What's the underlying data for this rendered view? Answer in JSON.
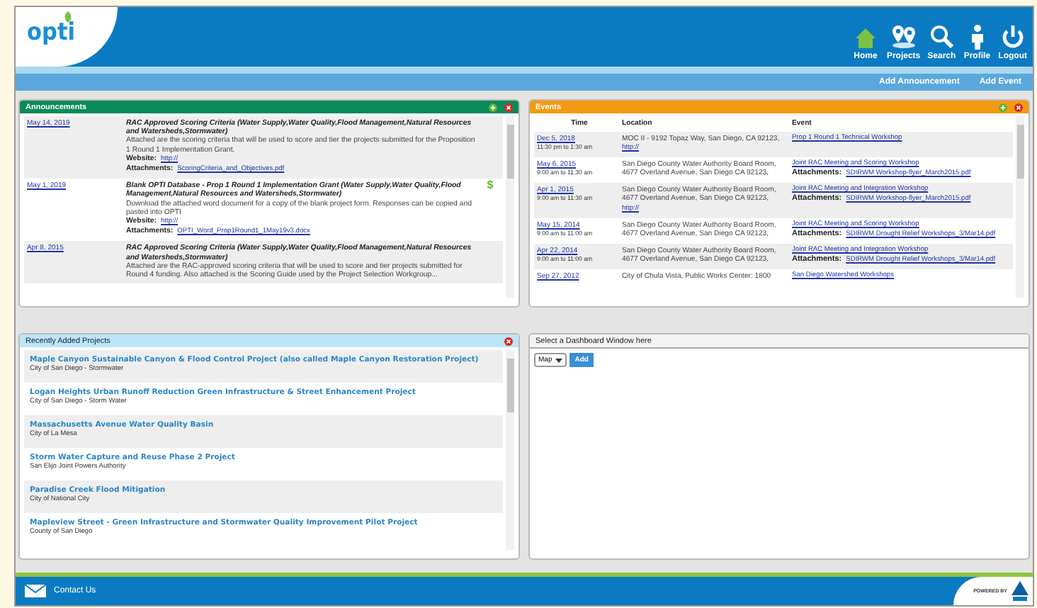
{
  "header": {
    "logo": "opti",
    "nav": [
      {
        "label": "Home",
        "kind": "home"
      },
      {
        "label": "Projects",
        "kind": "pins"
      },
      {
        "label": "Search",
        "kind": "search"
      },
      {
        "label": "Profile",
        "kind": "person"
      },
      {
        "label": "Logout",
        "kind": "power"
      }
    ]
  },
  "actions": [
    "Add Announcement",
    "Add Event"
  ],
  "announcements": {
    "title": "Announcements",
    "rows": [
      {
        "date": "May 14, 2019",
        "title": "RAC Approved Scoring Criteria (Water Supply,Water Quality,Flood Management,Natural Resources and Watersheds,Stormwater)",
        "text": "Attached are the scoring criteria that will be used to score and tier the projects submitted for the Proposition 1 Round 1 Implementation Grant.",
        "website_label": "Website:",
        "website": "http://",
        "attachments_label": "Attachments:",
        "attachment": "ScoringCriteria_and_Objectives.pdf"
      },
      {
        "date": "May 1, 2019",
        "title": "Blank OPTI Database - Prop 1 Round 1 Implementation Grant (Water Supply,Water Quality,Flood Management,Natural Resources and Watersheds,Stormwater)",
        "text": "Download the attached word document for a copy of the blank project form. Responses can be copied and pasted into OPTI",
        "website_label": "Website:",
        "website": "http://",
        "attachments_label": "Attachments:",
        "attachment": "OPTI_Word_Prop1Round1_1May19v3.docx",
        "badge": "$"
      },
      {
        "date": "Apr 8, 2015",
        "title": "RAC Approved Scoring Criteria (Water Supply,Water Quality,Flood Management,Natural Resources and Watersheds,Stormwater)",
        "text": "Attached are the RAC-approved scoring criteria that will be used to score and tier projects submitted for Round 4 funding. Also attached is the Scoring Guide used by the Project Selection Workgroup..."
      }
    ]
  },
  "events": {
    "title": "Events",
    "columns": [
      "Time",
      "Location",
      "Event"
    ],
    "rows": [
      {
        "date": "Dec 5, 2018",
        "time": "11:30 pm to 1:30 am",
        "location": "MOC II - 9192 Topaz Way, San Diego, CA 92123,",
        "location_link": "http://",
        "event": "Prop 1 Round 1 Technical Workshop"
      },
      {
        "date": "May 6, 2015",
        "time": "9:00 am to 11:30 am",
        "location": "San Diego County Water Authority Board Room, 4677 Overland Avenue, San Diego CA 92123,",
        "event": "Joint RAC Meeting and Scoring Workshop",
        "attachments_label": "Attachments:",
        "attachment": "SDIRWM Workshop-flyer_March2015.pdf"
      },
      {
        "date": "Apr 1, 2015",
        "time": "9:00 am to 11:30 am",
        "location": "San Diego County Water Authority Board Room, 4677 Overland Avenue, San Diego CA 92123,",
        "location_link": "http://",
        "event": "Joint RAC Meeting and Integration Workshop",
        "attachments_label": "Attachments:",
        "attachment": "SDIRWM Workshop-flyer_March2015.pdf"
      },
      {
        "date": "May 15, 2014",
        "time": "9:00 am to 11:00 am",
        "location": "San Diego County Water Authority Board Room, 4677 Overland Avenue, San Diego CA 92123,",
        "event": "Joint RAC Meeting and Scoring Workshop",
        "attachments_label": "Attachments:",
        "attachment": "SDIRWM Drought Relief Workshops_3/Mar14.pdf"
      },
      {
        "date": "Apr 22, 2014",
        "time": "9:00 am to 11:00 am",
        "location": "San Diego County Water Authority Board Room, 4677 Overland Avenue, San Diego CA 92123,",
        "event": "Joint RAC Meeting and Integration Workshop",
        "attachments_label": "Attachments:",
        "attachment": "SDIRWM Drought Relief Workshops_3/Mar14.pdf"
      },
      {
        "date": "Sep 27, 2012",
        "location": "City of Chula Vista, Public Works Center: 1800",
        "event": "San Diego Watershed Workshops"
      }
    ]
  },
  "projects": {
    "title": "Recently Added Projects",
    "items": [
      {
        "name": "Maple Canyon Sustainable Canyon & Flood Control Project (also called Maple Canyon Restoration Project)",
        "owner": "City of San Diego - Stormwater"
      },
      {
        "name": "Logan Heights Urban Runoff Reduction Green Infrastructure & Street Enhancement Project",
        "owner": "City of San Diego - Storm Water"
      },
      {
        "name": "Massachusetts Avenue Water Quality Basin",
        "owner": "City of La Mesa"
      },
      {
        "name": "Storm Water Capture and Reuse Phase 2 Project",
        "owner": "San Elijo Joint Powers Authority"
      },
      {
        "name": "Paradise Creek Flood Mitigation",
        "owner": "City of National City"
      },
      {
        "name": "Mapleview Street - Green Infrastructure and Stormwater Quality Improvement Pilot Project",
        "owner": "County of San Diego"
      }
    ]
  },
  "dashboard": {
    "title": "Select a Dashboard Window here",
    "select": "Map",
    "button": "Add"
  },
  "footer": {
    "contact": "Contact Us",
    "powered": "POWERED BY"
  }
}
